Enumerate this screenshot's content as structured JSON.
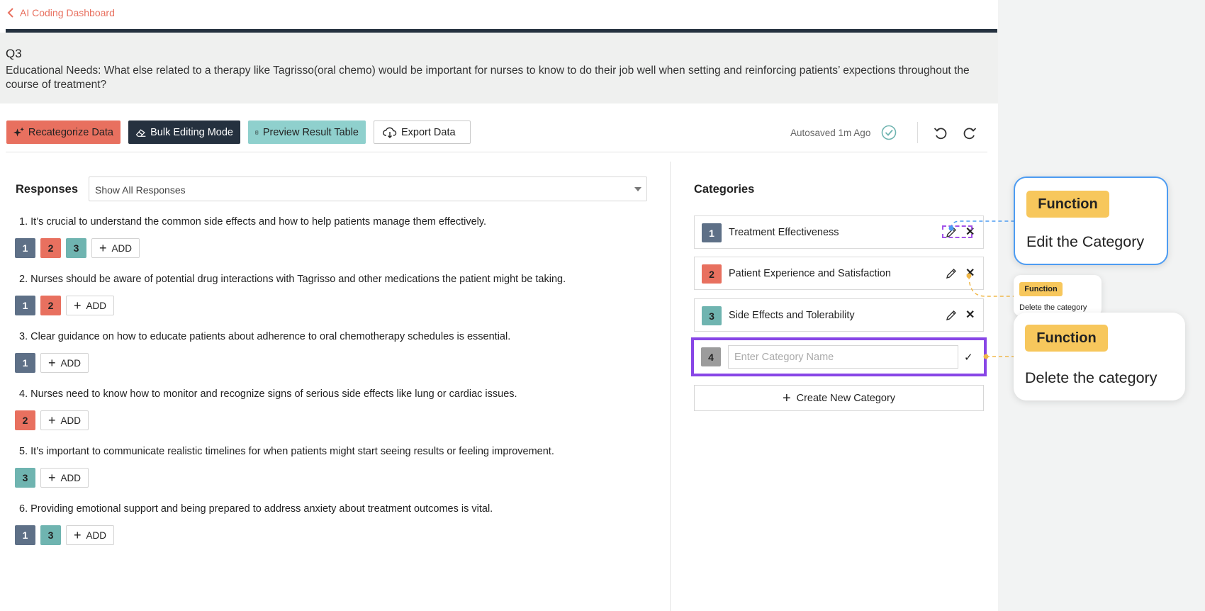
{
  "header": {
    "back_label": "AI Coding Dashboard"
  },
  "question": {
    "number": "Q3",
    "text": "Educational Needs: What else related to a therapy like Tagrisso(oral chemo) would be important for nurses to know to do their job well when setting and reinforcing patients’ expections throughout the course of treatment?"
  },
  "toolbar": {
    "recategorize_label": "Recategorize Data",
    "bulk_label": "Bulk Editing Mode",
    "preview_label": "Preview Result Table",
    "export_label": "Export Data",
    "autosave_text": "Autosaved 1m Ago"
  },
  "responses": {
    "title": "Responses",
    "filter_value": "Show All Responses",
    "add_label": "ADD",
    "items": [
      {
        "text": "1. It’s crucial to understand the common side effects and how to help patients manage them effectively.",
        "tags": [
          "1",
          "2",
          "3"
        ]
      },
      {
        "text": "2. Nurses should be aware of potential drug interactions with Tagrisso and other medications the patient might be taking.",
        "tags": [
          "1",
          "2"
        ]
      },
      {
        "text": "3. Clear guidance on how to educate patients about adherence to oral chemotherapy schedules is essential.",
        "tags": [
          "1"
        ]
      },
      {
        "text": "4. Nurses need to know how to monitor and recognize signs of serious side effects like lung or cardiac issues.",
        "tags": [
          "2"
        ]
      },
      {
        "text": "5. It’s important to communicate realistic timelines for when patients might start seeing results or feeling improvement.",
        "tags": [
          "3"
        ]
      },
      {
        "text": "6. Providing emotional support and being prepared to address anxiety about treatment outcomes is vital.",
        "tags": [
          "1",
          "3"
        ]
      }
    ]
  },
  "categories": {
    "title": "Categories",
    "items": [
      {
        "num": "1",
        "name": "Treatment Effectiveness",
        "color": "#5e7087"
      },
      {
        "num": "2",
        "name": "Patient Experience and Satisfaction",
        "color": "#e8705f"
      },
      {
        "num": "3",
        "name": "Side Effects and Tolerability",
        "color": "#6fb4b0"
      }
    ],
    "new_num": "4",
    "new_placeholder": "Enter Category Name",
    "create_label": "Create New Category"
  },
  "annotations": {
    "edit": {
      "badge": "Function",
      "desc": "Edit the Category"
    },
    "small": {
      "badge": "Function",
      "desc": "Delete the category"
    },
    "delete": {
      "badge": "Function",
      "desc": "Delete the category"
    }
  },
  "colors": {
    "cat1": "#5e7087",
    "cat2": "#e8705f",
    "cat3": "#6fb4b0",
    "highlight": "#8846e6",
    "badge": "#f7c75c"
  }
}
